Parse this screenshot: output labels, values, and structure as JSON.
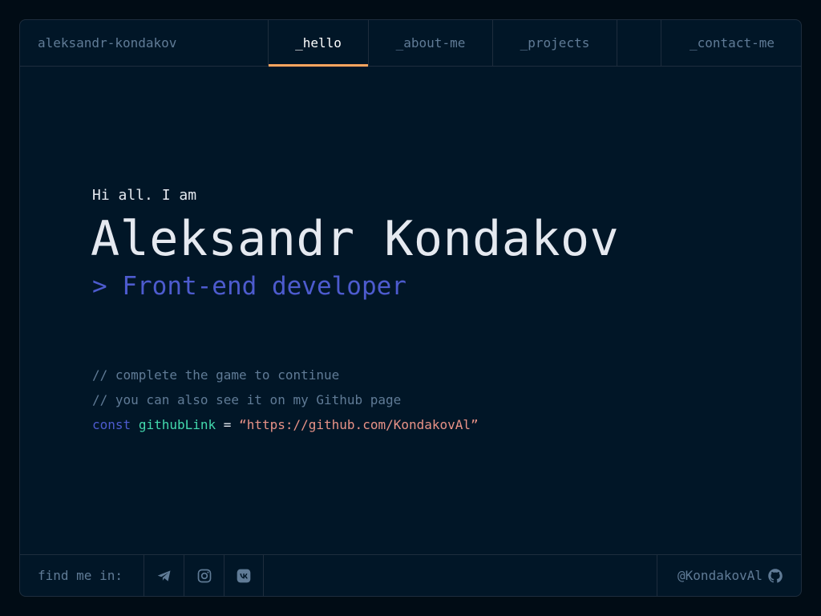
{
  "header": {
    "brand": "aleksandr-kondakov",
    "tabs": {
      "hello": "_hello",
      "about": "_about-me",
      "projects": "_projects",
      "contact": "_contact-me"
    },
    "active_tab": "_hello"
  },
  "hero": {
    "greeting": "Hi all. I am",
    "name": "Aleksandr Kondakov",
    "role": "> Front-end developer"
  },
  "code": {
    "comment1": "// complete the game to continue",
    "comment2": "// you can also see it on my Github page",
    "keyword": "const",
    "variable": "githubLink",
    "operator": "=",
    "value": "“https://github.com/KondakovAl”"
  },
  "footer": {
    "find_label": "find me in:",
    "socials": [
      "telegram-icon",
      "instagram-icon",
      "vk-icon"
    ],
    "handle": "@KondakovAl",
    "handle_icon": "github-icon"
  },
  "colors": {
    "background": "#010c15",
    "panel": "#011627",
    "border": "#1e2d3d",
    "accent_orange": "#fea55f",
    "accent_purple": "#4d5bce",
    "accent_green": "#43d9ad",
    "string": "#e99287",
    "muted": "#607b96"
  }
}
